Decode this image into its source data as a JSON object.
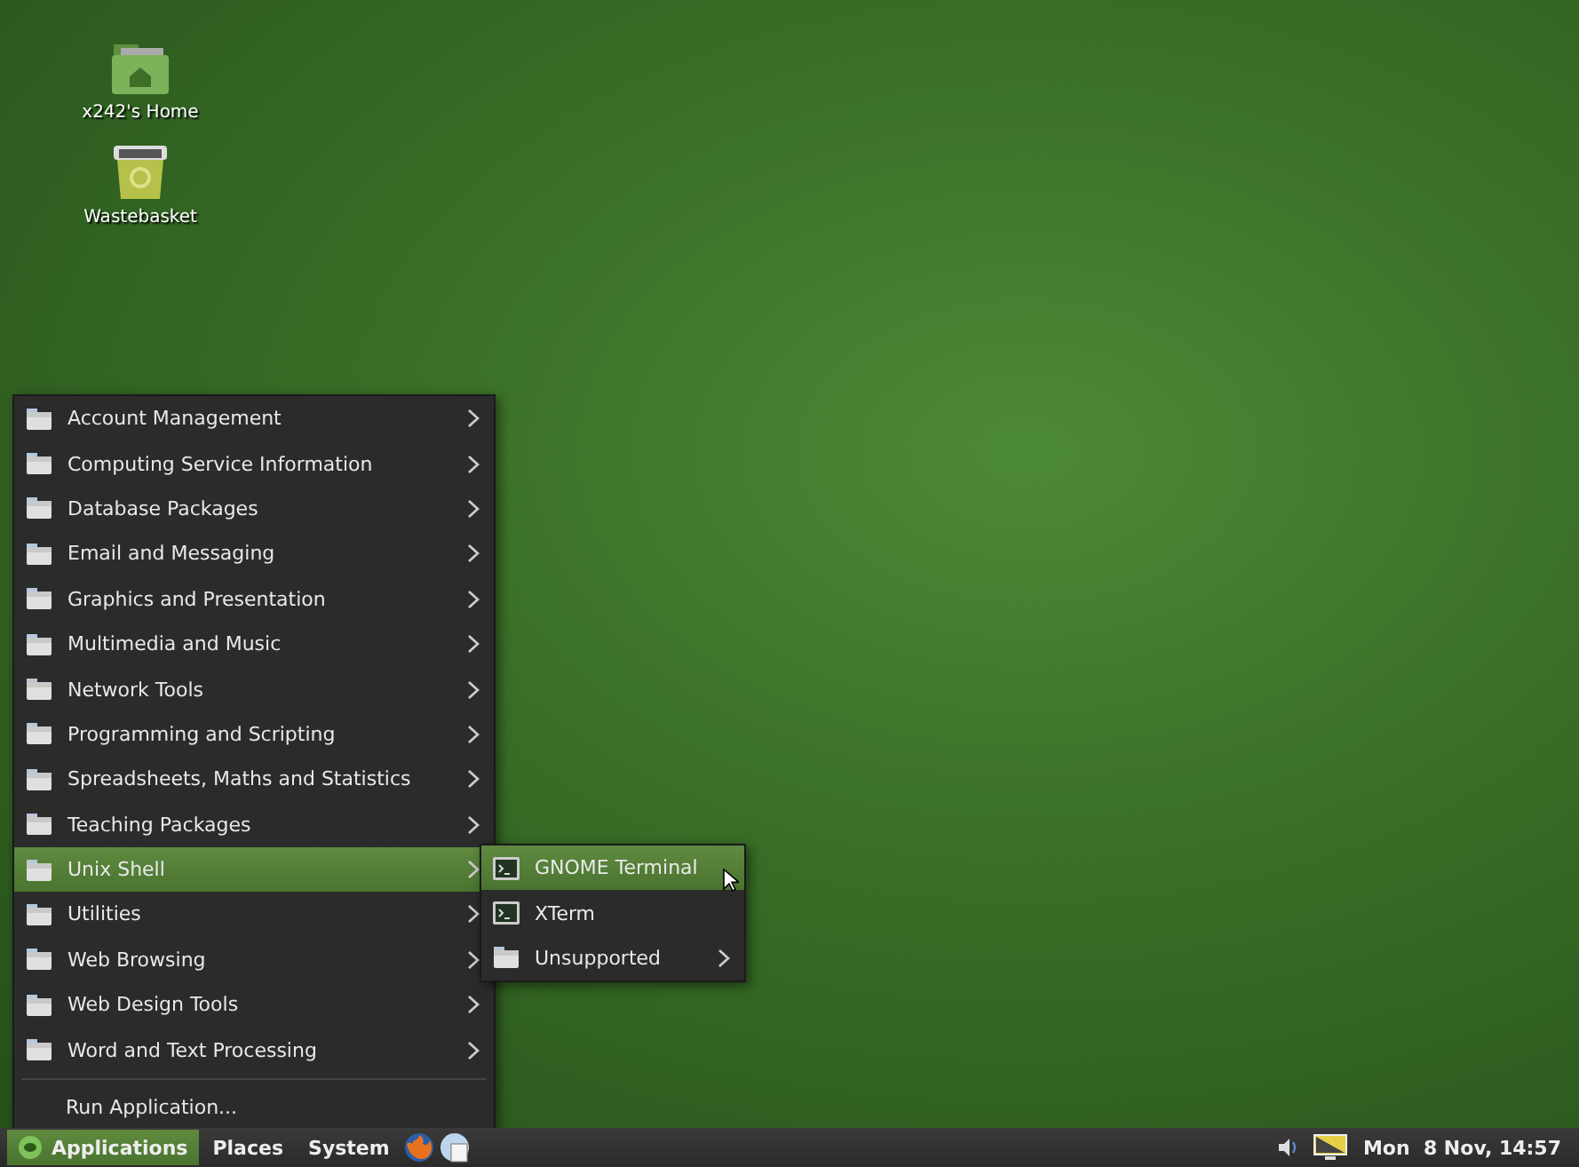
{
  "desktop_icons": [
    {
      "label": "x242's Home",
      "kind": "home"
    },
    {
      "label": "Wastebasket",
      "kind": "trash"
    }
  ],
  "menu": {
    "items": [
      {
        "label": "Account Management",
        "selected": false
      },
      {
        "label": "Computing Service Information",
        "selected": false
      },
      {
        "label": "Database Packages",
        "selected": false
      },
      {
        "label": "Email and Messaging",
        "selected": false
      },
      {
        "label": "Graphics and Presentation",
        "selected": false
      },
      {
        "label": "Multimedia and Music",
        "selected": false
      },
      {
        "label": "Network Tools",
        "selected": false
      },
      {
        "label": "Programming and Scripting",
        "selected": false
      },
      {
        "label": "Spreadsheets, Maths and Statistics",
        "selected": false
      },
      {
        "label": "Teaching Packages",
        "selected": false
      },
      {
        "label": "Unix Shell",
        "selected": true
      },
      {
        "label": "Utilities",
        "selected": false
      },
      {
        "label": "Web Browsing",
        "selected": false
      },
      {
        "label": "Web Design Tools",
        "selected": false
      },
      {
        "label": "Word and Text Processing",
        "selected": false
      }
    ],
    "footer": "Run Application..."
  },
  "submenu": {
    "items": [
      {
        "label": "GNOME Terminal",
        "kind": "app",
        "selected": true
      },
      {
        "label": "XTerm",
        "kind": "app",
        "selected": false
      },
      {
        "label": "Unsupported",
        "kind": "folder",
        "selected": false
      }
    ]
  },
  "panel": {
    "menus": [
      {
        "label": "Applications",
        "selected": true
      },
      {
        "label": "Places",
        "selected": false
      },
      {
        "label": "System",
        "selected": false
      }
    ],
    "clock": "Mon  8 Nov, 14:57"
  }
}
